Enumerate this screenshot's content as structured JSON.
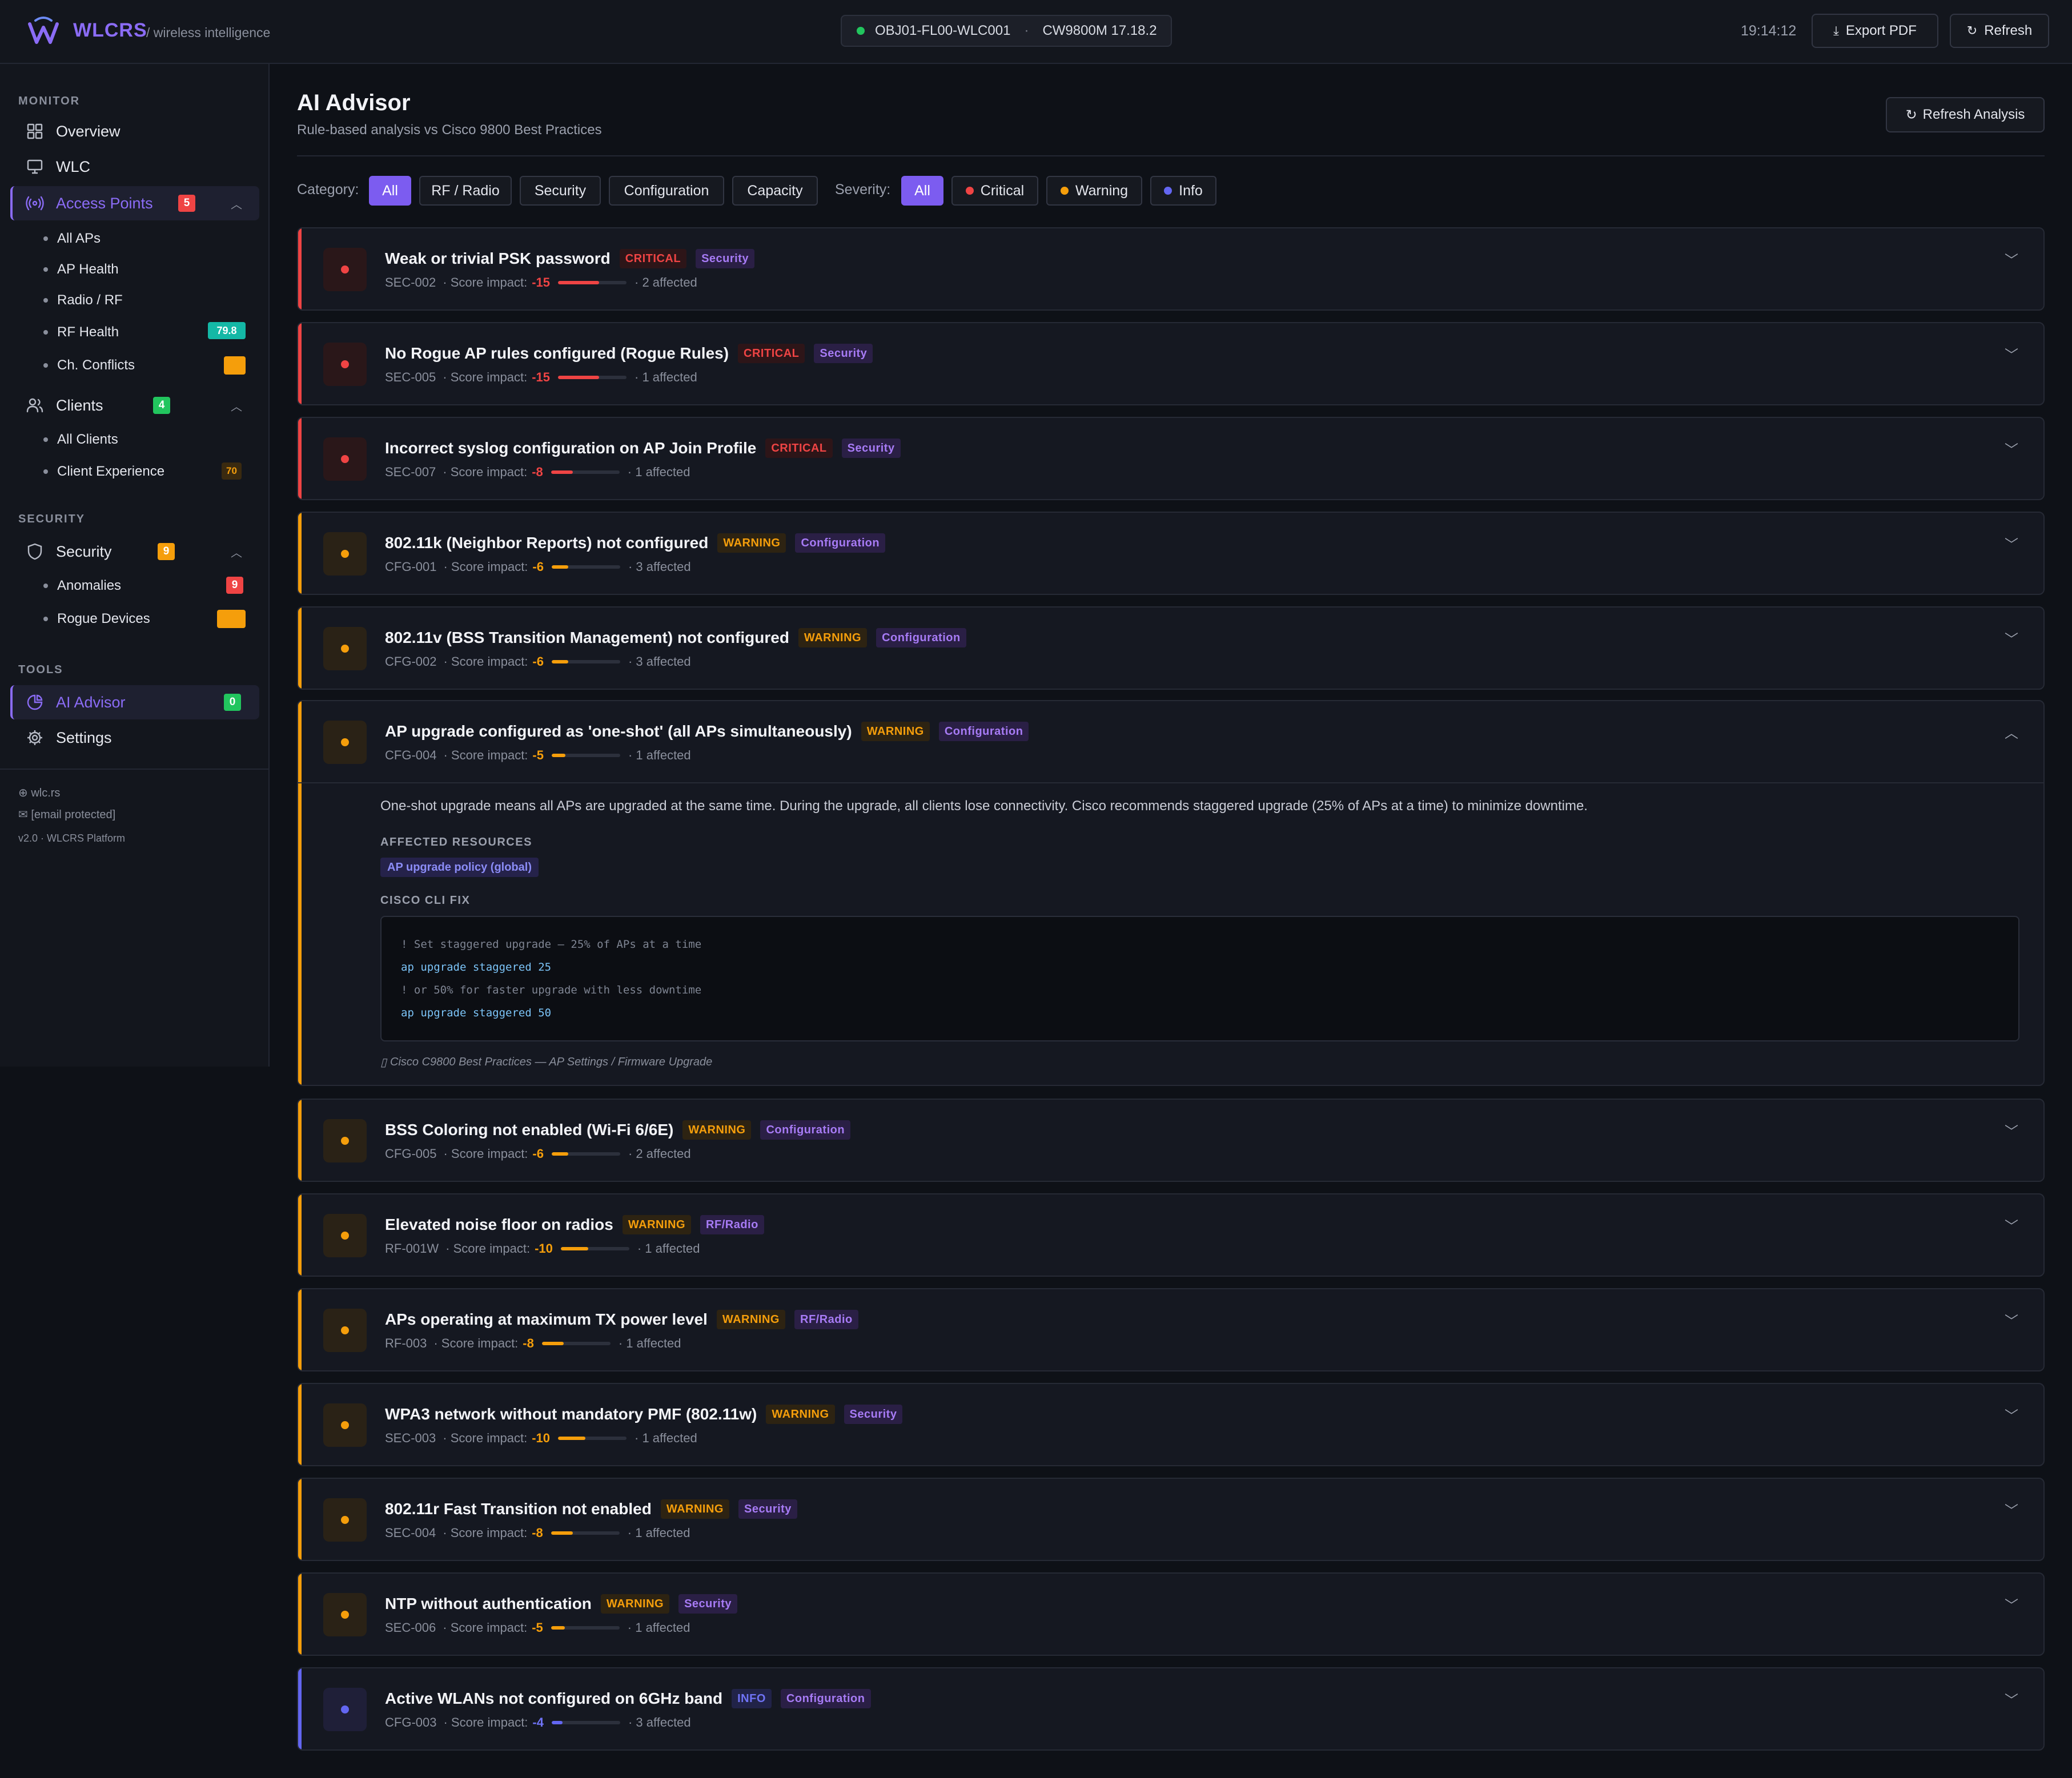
{
  "app": {
    "name": "WLCRS",
    "tagline": "/ wireless intelligence"
  },
  "controller": {
    "name": "OBJ01-FL00-WLC001",
    "separator": "·",
    "model": "CW9800M 17.18.2",
    "status_color": "#22c55e"
  },
  "topbar": {
    "clock": "19:14:12",
    "export_label": "Export PDF",
    "refresh_label": "Refresh"
  },
  "sidebar": {
    "monitor_label": "MONITOR",
    "overview": "Overview",
    "wlc": "WLC",
    "access_points": {
      "label": "Access Points",
      "badge": "5"
    },
    "ap_items": [
      {
        "label": "All APs",
        "badge": ""
      },
      {
        "label": "AP Health",
        "badge": ""
      },
      {
        "label": "Radio / RF",
        "badge": ""
      },
      {
        "label": "RF Health",
        "badge": "79.8"
      },
      {
        "label": "Ch. Conflicts",
        "badge": ""
      }
    ],
    "clients": {
      "label": "Clients",
      "badge": "4"
    },
    "client_items": [
      {
        "label": "All Clients",
        "badge": ""
      },
      {
        "label": "Client Experience",
        "badge": "70"
      }
    ],
    "security_label": "SECURITY",
    "security": {
      "label": "Security",
      "badge": "9"
    },
    "security_items": [
      {
        "label": "Anomalies",
        "badge": "9"
      },
      {
        "label": "Rogue Devices",
        "badge": ""
      }
    ],
    "tools_label": "TOOLS",
    "ai_advisor": {
      "label": "AI Advisor",
      "badge": "0"
    },
    "settings": "Settings",
    "footer": {
      "site": "wlc.rs",
      "email": "[email protected]",
      "version": "v2.0 · WLCRS Platform"
    }
  },
  "main": {
    "title": "AI Advisor",
    "subtitle": "Rule-based analysis vs Cisco 9800 Best Practices",
    "refresh_analysis": "Refresh Analysis",
    "category_label": "Category:",
    "categories": [
      "All",
      "RF / Radio",
      "Security",
      "Configuration",
      "Capacity"
    ],
    "severity_label": "Severity:",
    "severities": [
      "All",
      "Critical",
      "Warning",
      "Info"
    ]
  },
  "colors": {
    "accent": "#8b6cf6",
    "critical": "#ef4444",
    "warning": "#f59e0b",
    "info": "#6366f1",
    "success": "#22c55e"
  },
  "findings": [
    {
      "title": "Weak or trivial PSK password",
      "severity": "CRITICAL",
      "category": "Security",
      "id": "SEC-002",
      "impact_label": "· Score impact:",
      "impact": "-15",
      "impact_fraction": 0.6,
      "affected": "· 2 affected"
    },
    {
      "title": "No Rogue AP rules configured (Rogue Rules)",
      "severity": "CRITICAL",
      "category": "Security",
      "id": "SEC-005",
      "impact_label": "· Score impact:",
      "impact": "-15",
      "impact_fraction": 0.6,
      "affected": "· 1 affected"
    },
    {
      "title": "Incorrect syslog configuration on AP Join Profile",
      "severity": "CRITICAL",
      "category": "Security",
      "id": "SEC-007",
      "impact_label": "· Score impact:",
      "impact": "-8",
      "impact_fraction": 0.32,
      "affected": "· 1 affected"
    },
    {
      "title": "802.11k (Neighbor Reports) not configured",
      "severity": "WARNING",
      "category": "Configuration",
      "id": "CFG-001",
      "impact_label": "· Score impact:",
      "impact": "-6",
      "impact_fraction": 0.24,
      "affected": "· 3 affected"
    },
    {
      "title": "802.11v (BSS Transition Management) not configured",
      "severity": "WARNING",
      "category": "Configuration",
      "id": "CFG-002",
      "impact_label": "· Score impact:",
      "impact": "-6",
      "impact_fraction": 0.24,
      "affected": "· 3 affected"
    },
    {
      "title": "AP upgrade configured as 'one-shot' (all APs simultaneously)",
      "severity": "WARNING",
      "category": "Configuration",
      "id": "CFG-004",
      "impact_label": "· Score impact:",
      "impact": "-5",
      "impact_fraction": 0.2,
      "affected": "· 1 affected",
      "expanded": {
        "description": "One-shot upgrade means all APs are upgraded at the same time. During the upgrade, all clients lose connectivity. Cisco recommends staggered upgrade (25% of APs at a time) to minimize downtime.",
        "affected_label": "AFFECTED RESOURCES",
        "affected_resource": "AP upgrade policy (global)",
        "cli_label": "CISCO CLI FIX",
        "cli": [
          "! Set staggered upgrade — 25% of APs at a time",
          "ap upgrade staggered 25",
          "! or 50% for faster upgrade with less downtime",
          "ap upgrade staggered 50"
        ],
        "reference": "Cisco C9800 Best Practices — AP Settings / Firmware Upgrade"
      }
    },
    {
      "title": "BSS Coloring not enabled (Wi-Fi 6/6E)",
      "severity": "WARNING",
      "category": "Configuration",
      "id": "CFG-005",
      "impact_label": "· Score impact:",
      "impact": "-6",
      "impact_fraction": 0.24,
      "affected": "· 2 affected"
    },
    {
      "title": "Elevated noise floor on radios",
      "severity": "WARNING",
      "category": "RF/Radio",
      "id": "RF-001W",
      "impact_label": "· Score impact:",
      "impact": "-10",
      "impact_fraction": 0.4,
      "affected": "· 1 affected"
    },
    {
      "title": "APs operating at maximum TX power level",
      "severity": "WARNING",
      "category": "RF/Radio",
      "id": "RF-003",
      "impact_label": "· Score impact:",
      "impact": "-8",
      "impact_fraction": 0.32,
      "affected": "· 1 affected"
    },
    {
      "title": "WPA3 network without mandatory PMF (802.11w)",
      "severity": "WARNING",
      "category": "Security",
      "id": "SEC-003",
      "impact_label": "· Score impact:",
      "impact": "-10",
      "impact_fraction": 0.4,
      "affected": "· 1 affected"
    },
    {
      "title": "802.11r Fast Transition not enabled",
      "severity": "WARNING",
      "category": "Security",
      "id": "SEC-004",
      "impact_label": "· Score impact:",
      "impact": "-8",
      "impact_fraction": 0.32,
      "affected": "· 1 affected"
    },
    {
      "title": "NTP without authentication",
      "severity": "WARNING",
      "category": "Security",
      "id": "SEC-006",
      "impact_label": "· Score impact:",
      "impact": "-5",
      "impact_fraction": 0.2,
      "affected": "· 1 affected"
    },
    {
      "title": "Active WLANs not configured on 6GHz band",
      "severity": "INFO",
      "category": "Configuration",
      "id": "CFG-003",
      "impact_label": "· Score impact:",
      "impact": "-4",
      "impact_fraction": 0.16,
      "affected": "· 3 affected"
    }
  ]
}
